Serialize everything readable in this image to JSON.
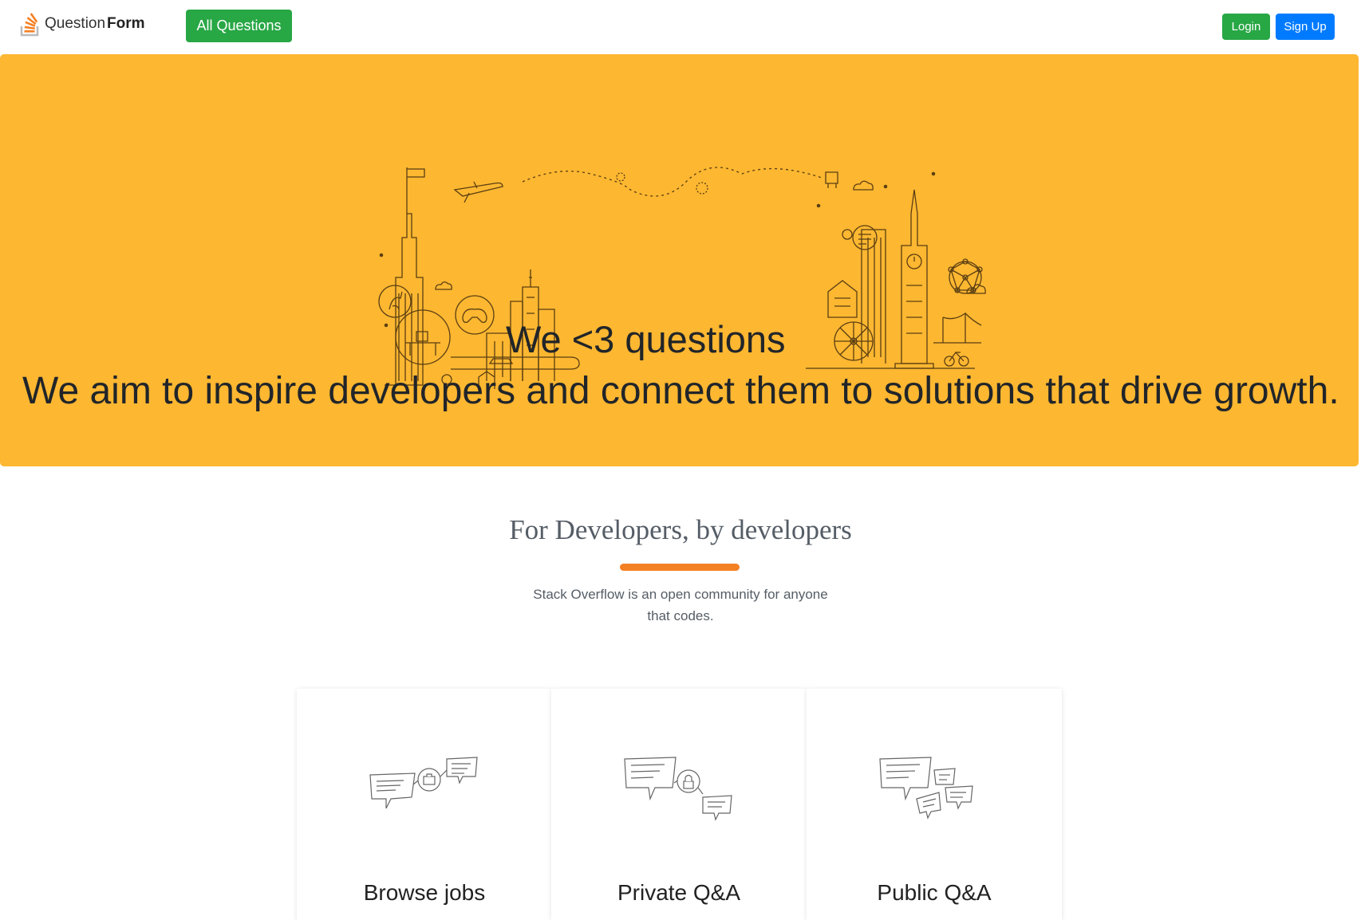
{
  "navbar": {
    "brand_text_regular": "Question",
    "brand_text_bold": "Form",
    "all_questions_label": "All Questions",
    "login_label": "Login",
    "signup_label": "Sign Up"
  },
  "hero": {
    "title": "We <3 questions",
    "subtitle": "We aim to inspire developers and connect them to solutions that drive growth.",
    "background_color": "#fdb731"
  },
  "section": {
    "title": "For Developers, by developers",
    "description": "Stack Overflow is an open community for anyone that codes.",
    "divider_color": "#f48024"
  },
  "cards": [
    {
      "title": "Browse jobs",
      "icon": "speech-bubbles-briefcase-icon"
    },
    {
      "title": "Private Q&A",
      "icon": "speech-bubbles-lock-icon"
    },
    {
      "title": "Public Q&A",
      "icon": "speech-bubbles-many-icon"
    }
  ],
  "colors": {
    "green_button": "#28a745",
    "blue_button": "#007bff",
    "logo_orange": "#f48024"
  }
}
